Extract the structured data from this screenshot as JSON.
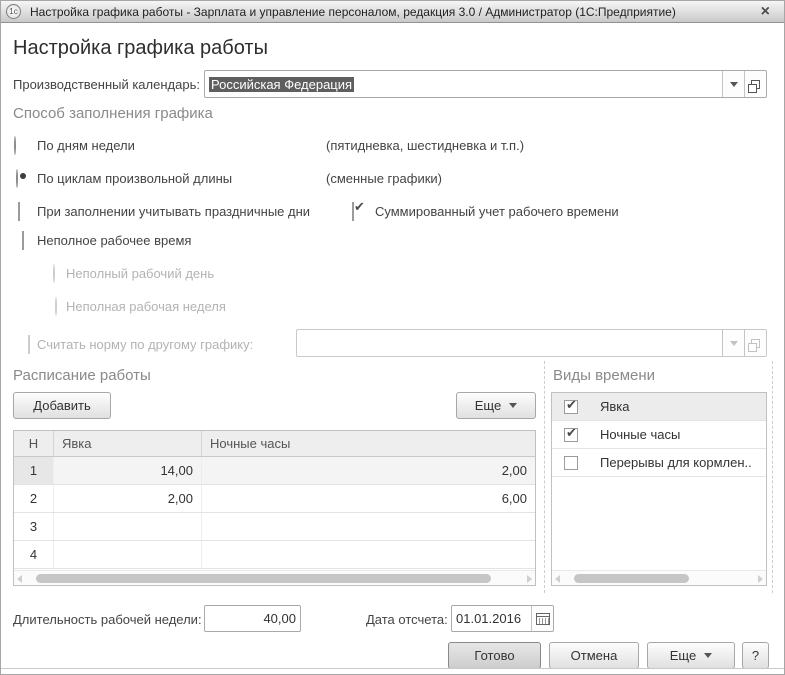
{
  "window": {
    "title": "Настройка графика работы - Зарплата и управление персоналом, редакция 3.0 / Администратор  (1С:Предприятие)",
    "logo_text": "1с",
    "close_glyph": "×"
  },
  "icons": {
    "check": "✔"
  },
  "page": {
    "title": "Настройка графика работы"
  },
  "calendar_field": {
    "label": "Производственный календарь:",
    "value": "Российская Федерация"
  },
  "fill_method": {
    "heading": "Способ заполнения графика",
    "options": [
      {
        "label": "По дням недели",
        "note": "(пятидневка, шестидневка и т.п.)",
        "selected": false
      },
      {
        "label": "По циклам произвольной длины",
        "note": "(сменные графики)",
        "selected": true
      }
    ]
  },
  "flags": {
    "holidays": {
      "label": "При заполнении учитывать праздничные дни",
      "checked": false
    },
    "summarized": {
      "label": "Суммированный учет рабочего времени",
      "checked": true
    },
    "part_time": {
      "label": "Неполное рабочее время",
      "checked": false
    },
    "part_day": {
      "label": "Неполный рабочий день",
      "enabled": false
    },
    "part_week": {
      "label": "Неполная рабочая неделя",
      "enabled": false
    },
    "other_schedule": {
      "label": "Считать норму по другому графику:",
      "value": "",
      "enabled": false
    }
  },
  "schedule": {
    "heading": "Расписание работы",
    "add_button": "Добавить",
    "more_button": "Еще",
    "table": {
      "columns": [
        "Н",
        "Явка",
        "Ночные часы"
      ],
      "rows": [
        {
          "n": "1",
          "yavka": "14,00",
          "night": "2,00",
          "selected": true
        },
        {
          "n": "2",
          "yavka": "2,00",
          "night": "6,00",
          "selected": false
        },
        {
          "n": "3",
          "yavka": "",
          "night": "",
          "selected": false
        },
        {
          "n": "4",
          "yavka": "",
          "night": "",
          "selected": false
        }
      ]
    }
  },
  "time_types": {
    "heading": "Виды времени",
    "items": [
      {
        "label": "Явка",
        "checked": true,
        "selected": true
      },
      {
        "label": "Ночные часы",
        "checked": true,
        "selected": false
      },
      {
        "label": "Перерывы для кормлен..",
        "checked": false,
        "selected": false
      }
    ]
  },
  "footer": {
    "week_length_label": "Длительность рабочей недели:",
    "week_length_value": "40,00",
    "start_date_label": "Дата отсчета:",
    "start_date_value": "01.01.2016",
    "done_button": "Готово",
    "cancel_button": "Отмена",
    "more_button": "Еще",
    "help_button": "?"
  }
}
